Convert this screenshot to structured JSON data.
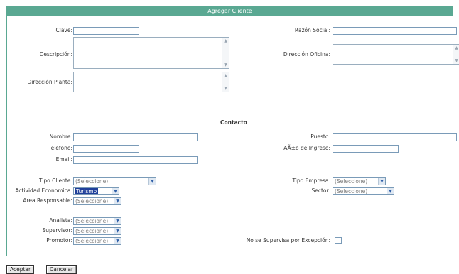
{
  "title": "Agregar Cliente",
  "labels": {
    "clave": "Clave:",
    "razon_social": "Razón Social:",
    "descripcion": "Descripción:",
    "direccion_oficina": "Dirección Oficina:",
    "direccion_planta": "Dirección Planta:",
    "contacto": "Contacto",
    "nombre": "Nombre:",
    "puesto": "Puesto:",
    "telefono": "Telefono:",
    "anio_ingreso": "AÃ±o de Ingreso:",
    "email": "Email:",
    "tipo_cliente": "Tipo Cliente:",
    "tipo_empresa": "Tipo Empresa:",
    "actividad_economica": "Actividad Economica:",
    "sector": "Sector:",
    "area_responsable": "Area Responsable:",
    "analista": "Analista:",
    "supervisor": "Supervisor:",
    "promotor": "Promotor:",
    "no_supervisa": "No se Supervisa por Excepción:"
  },
  "selects": {
    "tipo_cliente": "(Seleccione)",
    "tipo_empresa": "(Seleccione)",
    "actividad_economica": "Turismo",
    "sector": "(Seleccione)",
    "area_responsable": "(Seleccione)",
    "analista": "(Seleccione)",
    "supervisor": "(Seleccione)",
    "promotor": "(Seleccione)"
  },
  "buttons": {
    "aceptar": "Aceptar",
    "cancelar": "Cancelar"
  },
  "colors": {
    "accent": "#5aa892",
    "selected_highlight": "#1f3f9a"
  },
  "icons": {
    "dropdown": "chevron-down-icon",
    "scroll_up": "scroll-up-arrow-icon",
    "scroll_down": "scroll-down-arrow-icon"
  }
}
